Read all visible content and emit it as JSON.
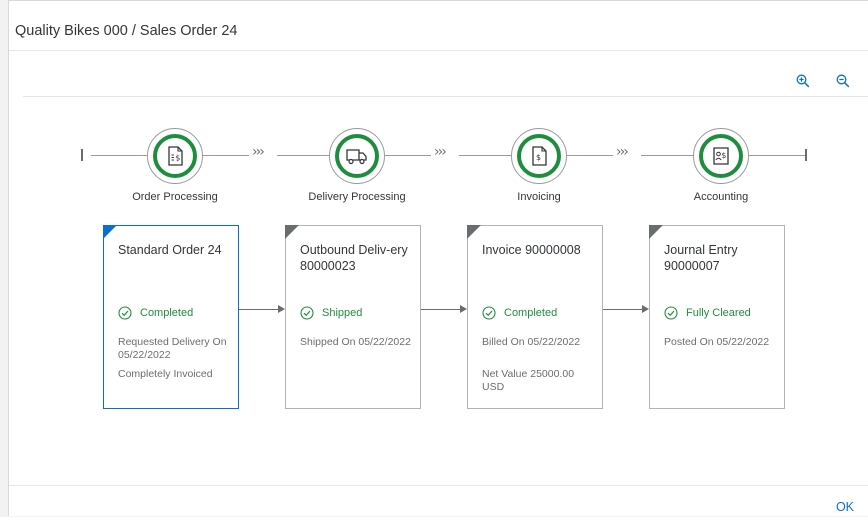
{
  "dialog": {
    "title": "Quality Bikes 000 / Sales Order 24",
    "ok_label": "OK"
  },
  "toolbar": {
    "zoom_in_icon": "zoom-in-icon",
    "zoom_out_icon": "zoom-out-icon"
  },
  "colors": {
    "accent": "#0a6ed1",
    "success": "#1e8e3e",
    "neutral": "#6a6d70"
  },
  "process_flow": {
    "lanes": [
      {
        "label": "Order Processing",
        "icon": "sales-order-icon"
      },
      {
        "label": "Delivery Processing",
        "icon": "shipping-truck-icon"
      },
      {
        "label": "Invoicing",
        "icon": "invoice-icon"
      },
      {
        "label": "Accounting",
        "icon": "accounting-document-icon"
      }
    ],
    "cards": [
      {
        "title": "Standard Order 24",
        "status": "Completed",
        "detail1": "Requested Delivery On 05/22/2022",
        "detail2": "Completely Invoiced"
      },
      {
        "title": "Outbound Deliv-ery 80000023",
        "status": "Shipped",
        "detail1": "Shipped On 05/22/2022",
        "detail2": ""
      },
      {
        "title": "Invoice 90000008",
        "status": "Completed",
        "detail1": "Billed On 05/22/2022",
        "detail2": "Net Value 25000.00 USD"
      },
      {
        "title": "Journal Entry 90000007",
        "status": "Fully Cleared",
        "detail1": "Posted On 05/22/2022",
        "detail2": ""
      }
    ]
  }
}
